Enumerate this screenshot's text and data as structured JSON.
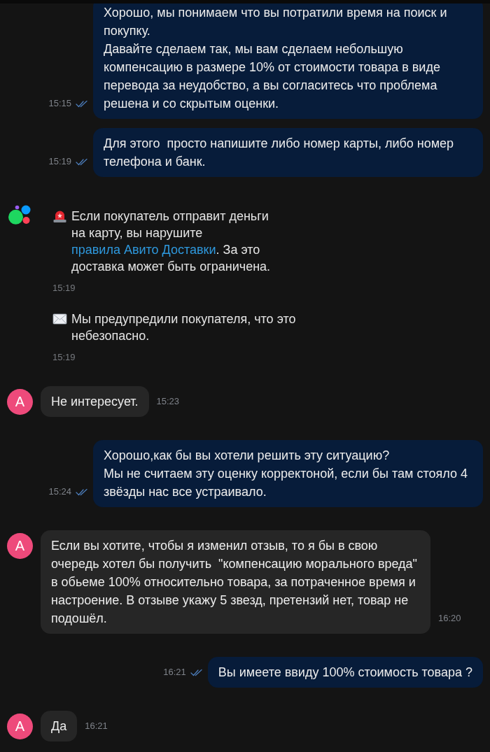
{
  "chat": {
    "messages": [
      {
        "kind": "outgoing",
        "text": "Хорошо, мы понимаем что вы потратили время на поиск и покупку.\nДавайте сделаем так, мы вам сделаем небольшую компенсацию в размере 10% от стоимости товара в виде перевода за неудобство, а вы согласитесь что проблема решена и со скрытым оценки.",
        "time": "15:15",
        "read": true
      },
      {
        "kind": "outgoing",
        "text": "Для этого  просто напишите либо номер карты, либо номер телефона и банк.",
        "time": "15:19",
        "read": true
      },
      {
        "kind": "alert",
        "logo": true,
        "parts": [
          {
            "text": "Если покупатель отправит деньги\nна карту, вы нарушите "
          },
          {
            "link": "правила Авито Доставки"
          },
          {
            "text": ". За это доставка может быть ограничена."
          }
        ],
        "time": "15:19"
      },
      {
        "kind": "notice",
        "logo": false,
        "parts": [
          {
            "text": "Мы предупредили покупателя, что это небезопасно."
          }
        ],
        "time": "15:19"
      },
      {
        "kind": "incoming",
        "avatar": "A",
        "text": "Не интересует.",
        "time": "15:23"
      },
      {
        "kind": "outgoing",
        "text": "Хорошо,как бы вы хотели решить эту ситуацию?\nМы не считаем эту оценку корректоной, если бы там стояло 4 звёзды нас все устраивало.",
        "time": "15:24",
        "read": true
      },
      {
        "kind": "incoming",
        "avatar": "A",
        "text": "Если вы хотите, чтобы я изменил отзыв, то я бы в свою очередь хотел бы получить  \"компенсацию морального вреда\" в обьеме 100% относительно товара, за потраченное время и настроение. В отзыве укажу 5 звезд, претензий нет, товар не подошёл.",
        "time": "16:20"
      },
      {
        "kind": "outgoing",
        "text": "Вы имеете ввиду 100% стоимость товара ?",
        "time": "16:21",
        "read": true
      },
      {
        "kind": "incoming",
        "avatar": "A",
        "text": "Да",
        "time": "16:21"
      }
    ]
  }
}
